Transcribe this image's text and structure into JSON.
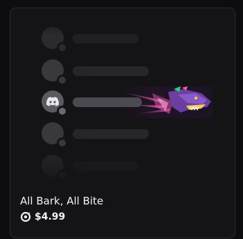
{
  "product": {
    "name": "All Bark, All Bite",
    "price": "$4.99"
  },
  "icons": {
    "currency": "orb-icon",
    "app": "discord-logo-icon"
  },
  "preview": {
    "rows": 5,
    "highlighted_row": 3
  }
}
